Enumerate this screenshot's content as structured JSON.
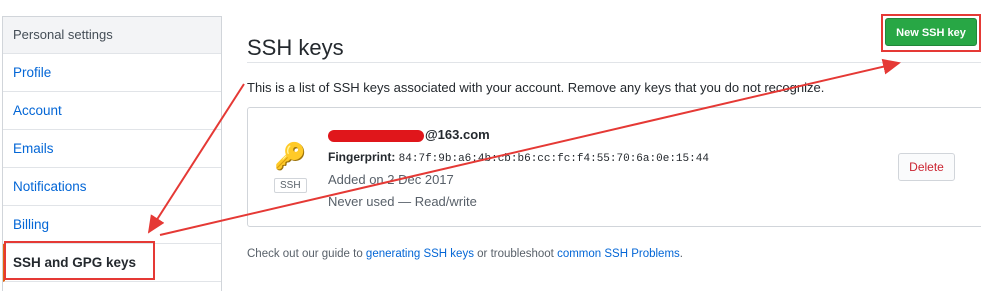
{
  "sidebar": {
    "header": "Personal settings",
    "items": [
      {
        "label": "Profile"
      },
      {
        "label": "Account"
      },
      {
        "label": "Emails"
      },
      {
        "label": "Notifications"
      },
      {
        "label": "Billing"
      },
      {
        "label": "SSH and GPG keys"
      }
    ]
  },
  "main": {
    "title": "SSH keys",
    "new_button": "New SSH key",
    "description": "This is a list of SSH keys associated with your account. Remove any keys that you do not recognize.",
    "key": {
      "title_suffix": "@163.com",
      "fingerprint_label": "Fingerprint:",
      "fingerprint": "84:7f:9b:a6:4b:cb:b6:cc:fc:f4:55:70:6a:0e:15:44",
      "badge": "SSH",
      "added": "Added on 2 Dec 2017",
      "usage": "Never used — Read/write",
      "delete_button": "Delete"
    },
    "guide": {
      "pre": "Check out our guide to ",
      "link1": "generating SSH keys",
      "mid": " or troubleshoot ",
      "link2": "common SSH Problems",
      "post": "."
    }
  },
  "annotation_color": "#e53935"
}
